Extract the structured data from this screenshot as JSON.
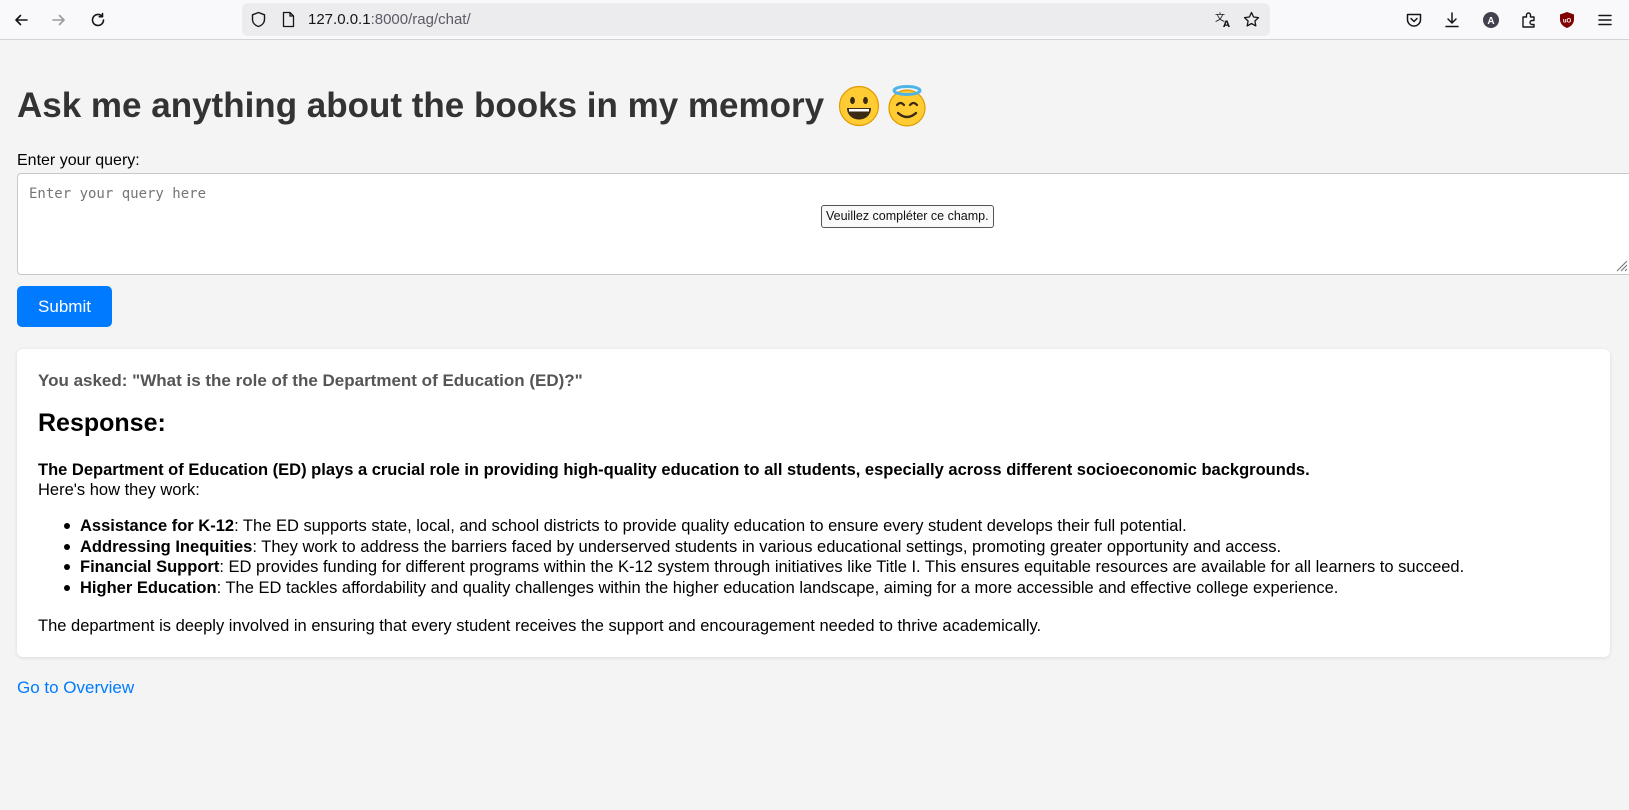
{
  "browser": {
    "url_host": "127.0.0.1",
    "url_rest": ":8000/rag/chat/",
    "icons": [
      "back-icon",
      "forward-icon",
      "reload-icon",
      "shield-icon",
      "page-icon",
      "translate-icon",
      "star-icon",
      "pocket-icon",
      "download-icon",
      "account-icon",
      "extensions-icon",
      "ublock-icon",
      "menu-icon"
    ]
  },
  "page": {
    "title": "Ask me anything about the books in my memory",
    "query_label": "Enter your query:",
    "query_placeholder": "Enter your query here",
    "validation_tooltip": "Veuillez compléter ce champ.",
    "submit_label": "Submit"
  },
  "response": {
    "you_asked": "You asked: \"What is the role of the Department of Education (ED)?\"",
    "heading": "Response:",
    "lead": "The Department of Education (ED) plays a crucial role in providing high-quality education to all students, especially across different socioeconomic backgrounds.",
    "intro": "Here's how they work:",
    "items": [
      {
        "title": "Assistance for K-12",
        "text": ": The ED supports state, local, and school districts to provide quality education to ensure every student develops their full potential."
      },
      {
        "title": "Addressing Inequities",
        "text": ": They work to address the barriers faced by underserved students in various educational settings, promoting greater opportunity and access."
      },
      {
        "title": "Financial Support",
        "text": ": ED provides funding for different programs within the K-12 system through initiatives like Title I. This ensures equitable resources are available for all learners to succeed."
      },
      {
        "title": "Higher Education",
        "text": ": The ED tackles affordability and quality challenges within the higher education landscape, aiming for a more accessible and effective college experience."
      }
    ],
    "outro": "The department is deeply involved in ensuring that every student receives the support and encouragement needed to thrive academically."
  },
  "footer": {
    "overview_link": "Go to Overview"
  },
  "colors": {
    "accent": "#007bff",
    "background": "#f4f4f5",
    "title_text": "#333333"
  }
}
